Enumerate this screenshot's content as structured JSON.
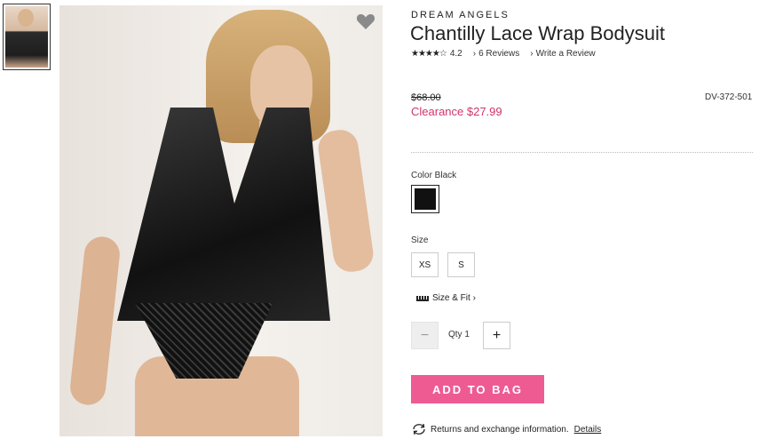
{
  "product": {
    "brand": "DREAM ANGELS",
    "title": "Chantilly Lace Wrap Bodysuit",
    "rating": "4.2",
    "stars": "★★★★☆",
    "reviews_label": "6 Reviews",
    "write_review_label": "Write a Review",
    "original_price": "$68.00",
    "clearance_price": "Clearance $27.99",
    "sku": "DV-372-501"
  },
  "options": {
    "color_label": "Color Black",
    "selected_color": "#111111",
    "size_label": "Size",
    "sizes": [
      "XS",
      "S"
    ],
    "size_fit_label": "Size & Fit ›"
  },
  "quantity": {
    "label": "Qty 1",
    "minus": "−",
    "plus": "+"
  },
  "actions": {
    "add_to_bag": "ADD TO BAG"
  },
  "returns": {
    "text": "Returns and exchange information.",
    "details": "Details"
  },
  "colors": {
    "accent_pink": "#ee5b93",
    "clearance_pink": "#d1346e"
  }
}
